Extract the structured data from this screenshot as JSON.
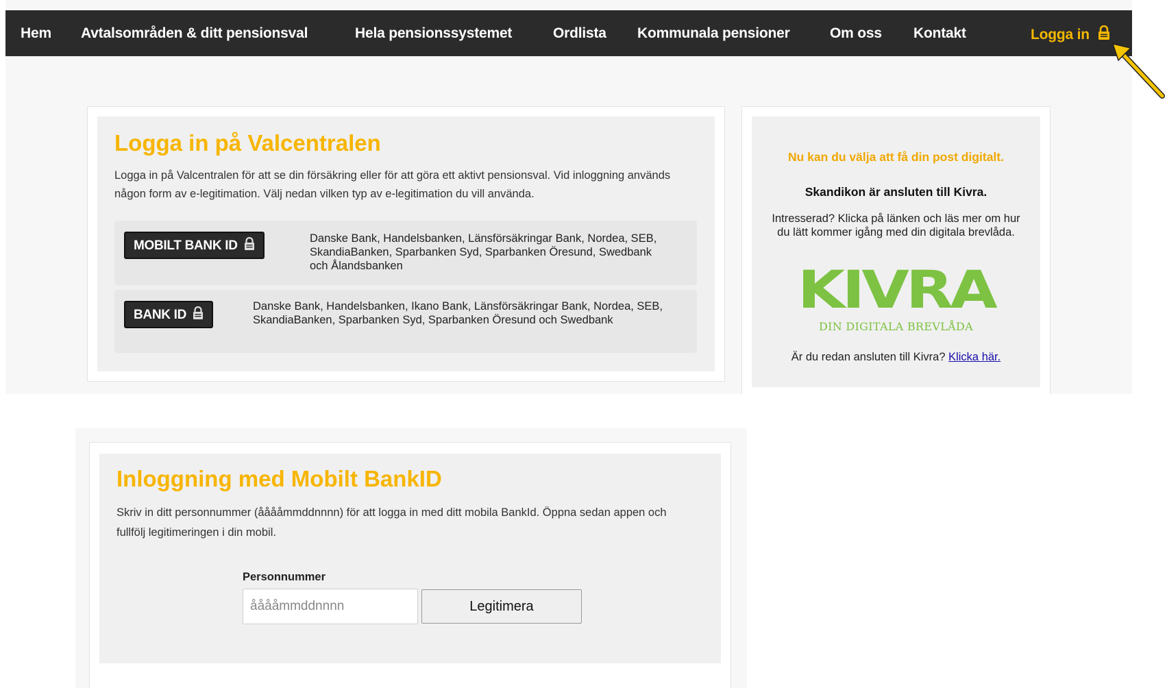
{
  "nav": {
    "items": [
      "Hem",
      "Avtalsområden & ditt pensionsval",
      "Hela pensionssystemet",
      "Ordlista",
      "Kommunala pensioner",
      "Om oss",
      "Kontakt"
    ],
    "login_label": "Logga in",
    "login_icon": "lock-icon",
    "login_color": "#f5b800"
  },
  "login_card": {
    "title": "Logga in på Valcentralen",
    "description": "Logga in på Valcentralen för att se din försäkring eller för att göra ett aktivt pensionsval. Vid inloggning används någon form av e-legitimation. Välj nedan vilken typ av e-legitimation du vill använda.",
    "options": [
      {
        "button": "MOBILT BANK ID",
        "icon": "lock-icon",
        "banks": "Danske Bank, Handelsbanken, Länsförsäkringar Bank, Nordea, SEB, SkandiaBanken, Sparbanken Syd, Sparbanken Öresund, Swedbank och Ålandsbanken"
      },
      {
        "button": "BANK ID",
        "icon": "lock-icon",
        "banks": "Danske Bank, Handelsbanken, Ikano Bank, Länsförsäkringar Bank, Nordea, SEB, SkandiaBanken, Sparbanken Syd, Sparbanken Öresund och Swedbank"
      }
    ]
  },
  "kivra_card": {
    "headline": "Nu kan du välja att få din post digitalt.",
    "subheadline": "Skandikon är ansluten till Kivra.",
    "body": "Intresserad? Klicka på länken och läs mer om hur du lätt kommer igång med din digitala brevlåda.",
    "logo_text": "KIVRA",
    "logo_tagline": "DIN DIGITALA BREVLÅDA",
    "logo_color": "#7dc242",
    "footer_text": "Är du redan ansluten till Kivra?",
    "footer_link": "Klicka här."
  },
  "mobile_login": {
    "title": "Inloggning med Mobilt BankID",
    "description": "Skriv in ditt personnummer (ååååmmddnnnn) för att logga in med ditt mobila BankId. Öppna sedan appen och fullfölj legitimeringen i din mobil.",
    "field_label": "Personnummer",
    "field_placeholder": "ååååmmddnnnn",
    "submit_label": "Legitimera"
  },
  "colors": {
    "accent": "#f7b500",
    "nav_bg": "#2b2b2b",
    "arrow": "#f5c400"
  }
}
